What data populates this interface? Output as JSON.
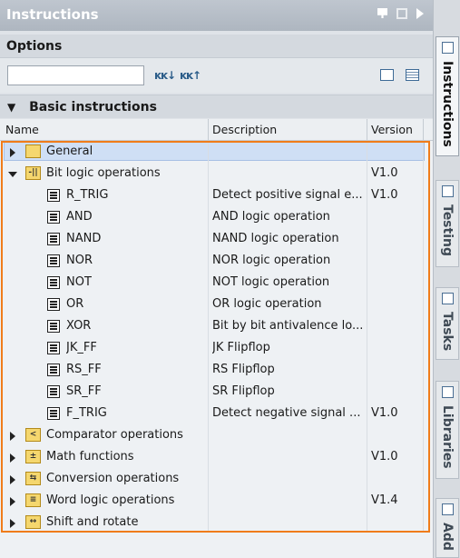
{
  "window": {
    "title": "Instructions"
  },
  "options": {
    "title": "Options",
    "search_value": "",
    "tool1": "ĸĸ↓",
    "tool2": "ĸĸ↑"
  },
  "basic": {
    "title": "Basic instructions"
  },
  "columns": {
    "name": "Name",
    "description": "Description",
    "version": "Version"
  },
  "rows": [
    {
      "label": "General",
      "desc": "",
      "ver": "",
      "kind": "folder",
      "expand": "collapsed",
      "icon_text": ""
    },
    {
      "label": "Bit logic operations",
      "desc": "",
      "ver": "V1.0",
      "kind": "folder",
      "expand": "expanded",
      "icon_text": "-||"
    },
    {
      "label": "R_TRIG",
      "desc": "Detect positive signal e...",
      "ver": "V1.0",
      "kind": "block"
    },
    {
      "label": "AND",
      "desc": "AND logic operation",
      "ver": "",
      "kind": "block"
    },
    {
      "label": "NAND",
      "desc": "NAND logic operation",
      "ver": "",
      "kind": "block"
    },
    {
      "label": "NOR",
      "desc": "NOR logic operation",
      "ver": "",
      "kind": "block"
    },
    {
      "label": "NOT",
      "desc": "NOT logic operation",
      "ver": "",
      "kind": "block"
    },
    {
      "label": "OR",
      "desc": "OR logic operation",
      "ver": "",
      "kind": "block"
    },
    {
      "label": "XOR",
      "desc": "Bit by bit antivalence lo...",
      "ver": "",
      "kind": "block"
    },
    {
      "label": "JK_FF",
      "desc": "JK Flipflop",
      "ver": "",
      "kind": "block"
    },
    {
      "label": "RS_FF",
      "desc": "RS Flipflop",
      "ver": "",
      "kind": "block"
    },
    {
      "label": "SR_FF",
      "desc": "SR Flipflop",
      "ver": "",
      "kind": "block"
    },
    {
      "label": "F_TRIG",
      "desc": "Detect negative signal ...",
      "ver": "V1.0",
      "kind": "block"
    },
    {
      "label": "Comparator operations",
      "desc": "",
      "ver": "",
      "kind": "folder",
      "expand": "collapsed",
      "icon_text": "<"
    },
    {
      "label": "Math functions",
      "desc": "",
      "ver": "V1.0",
      "kind": "folder",
      "expand": "collapsed",
      "icon_text": "±"
    },
    {
      "label": "Conversion operations",
      "desc": "",
      "ver": "",
      "kind": "folder",
      "expand": "collapsed",
      "icon_text": "⇆"
    },
    {
      "label": "Word logic operations",
      "desc": "",
      "ver": "V1.4",
      "kind": "folder",
      "expand": "collapsed",
      "icon_text": "≡"
    },
    {
      "label": "Shift and rotate",
      "desc": "",
      "ver": "",
      "kind": "folder",
      "expand": "collapsed",
      "icon_text": "↔"
    }
  ],
  "sidebar": {
    "tabs": [
      {
        "label": "Instructions",
        "active": true
      },
      {
        "label": "Testing",
        "active": false
      },
      {
        "label": "Tasks",
        "active": false
      },
      {
        "label": "Libraries",
        "active": false
      },
      {
        "label": "Add",
        "active": false
      }
    ]
  },
  "colors": {
    "highlight": "#f07c1a",
    "selected_row": "#cfdff5"
  }
}
